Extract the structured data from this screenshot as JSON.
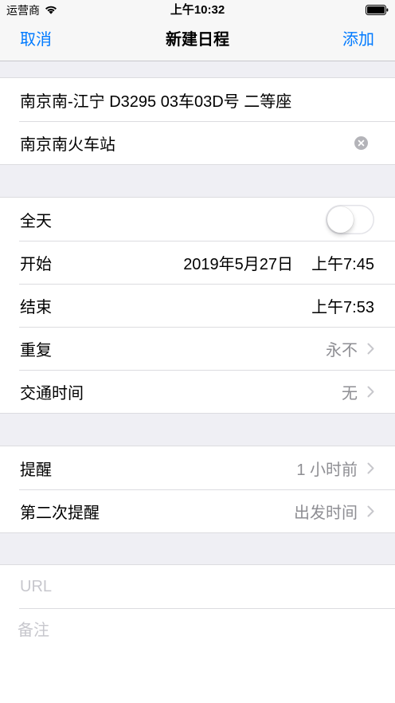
{
  "status_bar": {
    "carrier": "运营商",
    "time": "上午10:32",
    "battery_level": 1
  },
  "nav": {
    "cancel": "取消",
    "title": "新建日程",
    "add": "添加"
  },
  "event": {
    "title": "南京南-江宁 D3295 03车03D号 二等座",
    "location": "南京南火车站"
  },
  "timing": {
    "all_day": {
      "label": "全天",
      "on": false
    },
    "start": {
      "label": "开始",
      "date": "2019年5月27日",
      "time": "上午7:45"
    },
    "end": {
      "label": "结束",
      "time": "上午7:53"
    },
    "repeat": {
      "label": "重复",
      "value": "永不"
    },
    "travel_time": {
      "label": "交通时间",
      "value": "无"
    }
  },
  "alerts": {
    "first": {
      "label": "提醒",
      "value": "1 小时前"
    },
    "second": {
      "label": "第二次提醒",
      "value": "出发时间"
    }
  },
  "notes": {
    "url_placeholder": "URL",
    "notes_placeholder": "备注"
  },
  "icons": {
    "wifi": "wifi-icon",
    "battery": "battery-icon",
    "clear": "clear-icon",
    "chevron": "chevron-right-icon"
  },
  "colors": {
    "accent": "#007aff",
    "background": "#efeff4",
    "secondary_text": "#8e8e93",
    "placeholder": "#c7c7cd",
    "chevron": "#c7c7cc"
  }
}
